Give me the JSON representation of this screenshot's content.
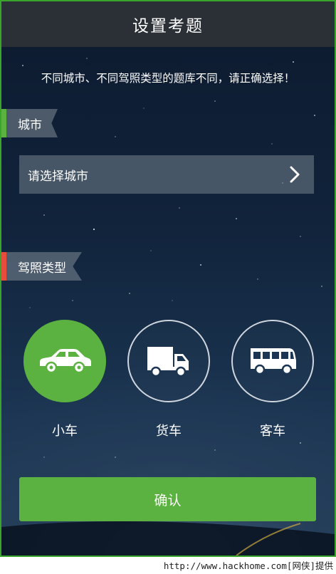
{
  "header": {
    "title": "设置考题"
  },
  "notice": "不同城市、不同驾照类型的题库不同，请正确选择！",
  "city_section": {
    "tag_label": "城市",
    "tag_color": "#5bb240",
    "select_placeholder": "请选择城市"
  },
  "license_section": {
    "tag_label": "驾照类型",
    "tag_color": "#e84c3d",
    "options": [
      {
        "label": "小车",
        "icon": "car-icon",
        "selected": true
      },
      {
        "label": "货车",
        "icon": "truck-icon",
        "selected": false
      },
      {
        "label": "客车",
        "icon": "bus-icon",
        "selected": false
      }
    ]
  },
  "confirm_label": "确认",
  "watermark": "http://www.hackhome.com[网侠]提供",
  "colors": {
    "accent": "#5bb240",
    "header_bg": "#2b2f36",
    "frame": "#3aa52c"
  }
}
